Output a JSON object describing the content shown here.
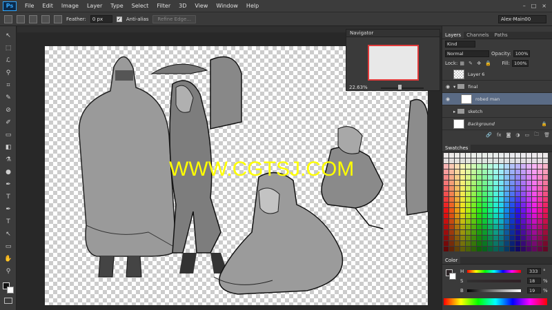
{
  "menu": {
    "logo": "Ps",
    "items": [
      "File",
      "Edit",
      "Image",
      "Layer",
      "Type",
      "Select",
      "Filter",
      "3D",
      "View",
      "Window",
      "Help"
    ],
    "window_controls": [
      "–",
      "□",
      "×"
    ]
  },
  "options": {
    "feather_label": "Feather:",
    "feather_value": "0 px",
    "antialias_label": "Anti-alias",
    "antialias_check": "✓",
    "refine_edge": "Refine Edge...",
    "workspace": "Alex-Main00"
  },
  "tools": [
    "↖",
    "⬚",
    "ℒ",
    "⚲",
    "⌗",
    "✎",
    "⊘",
    "✐",
    "▭",
    "◧",
    "⚗",
    "●",
    "✒",
    "T",
    "↖",
    "▭",
    "✋",
    "⚲"
  ],
  "navigator": {
    "title": "Navigator",
    "zoom": "22.63%"
  },
  "canvas": {
    "watermark": "WWW.CGTSJ.COM"
  },
  "layers": {
    "tabs": [
      "Layers",
      "Channels",
      "Paths"
    ],
    "filter_kind": "Kind",
    "blend_mode": "Normal",
    "opacity_label": "Opacity:",
    "opacity_value": "100%",
    "lock_label": "Lock:",
    "fill_label": "Fill:",
    "fill_value": "100%",
    "items": [
      {
        "name": "Layer 6"
      },
      {
        "name": "final"
      },
      {
        "name": "robed man"
      },
      {
        "name": "sketch"
      },
      {
        "name": "Background"
      }
    ],
    "footer_icons": [
      "🔗",
      "fx",
      "◙",
      "◑",
      "▭",
      "🗀",
      "🗑"
    ]
  },
  "swatches": {
    "title": "Swatches"
  },
  "color": {
    "title": "Color",
    "h_label": "H",
    "h_value": "333",
    "h_unit": "°",
    "s_label": "S",
    "s_value": "18",
    "s_unit": "%",
    "b_label": "B",
    "b_value": "19",
    "b_unit": "%"
  },
  "colors": {
    "accent": "#5a6b85",
    "nav_frame": "#e23b3b",
    "watermark": "#ffff00"
  }
}
